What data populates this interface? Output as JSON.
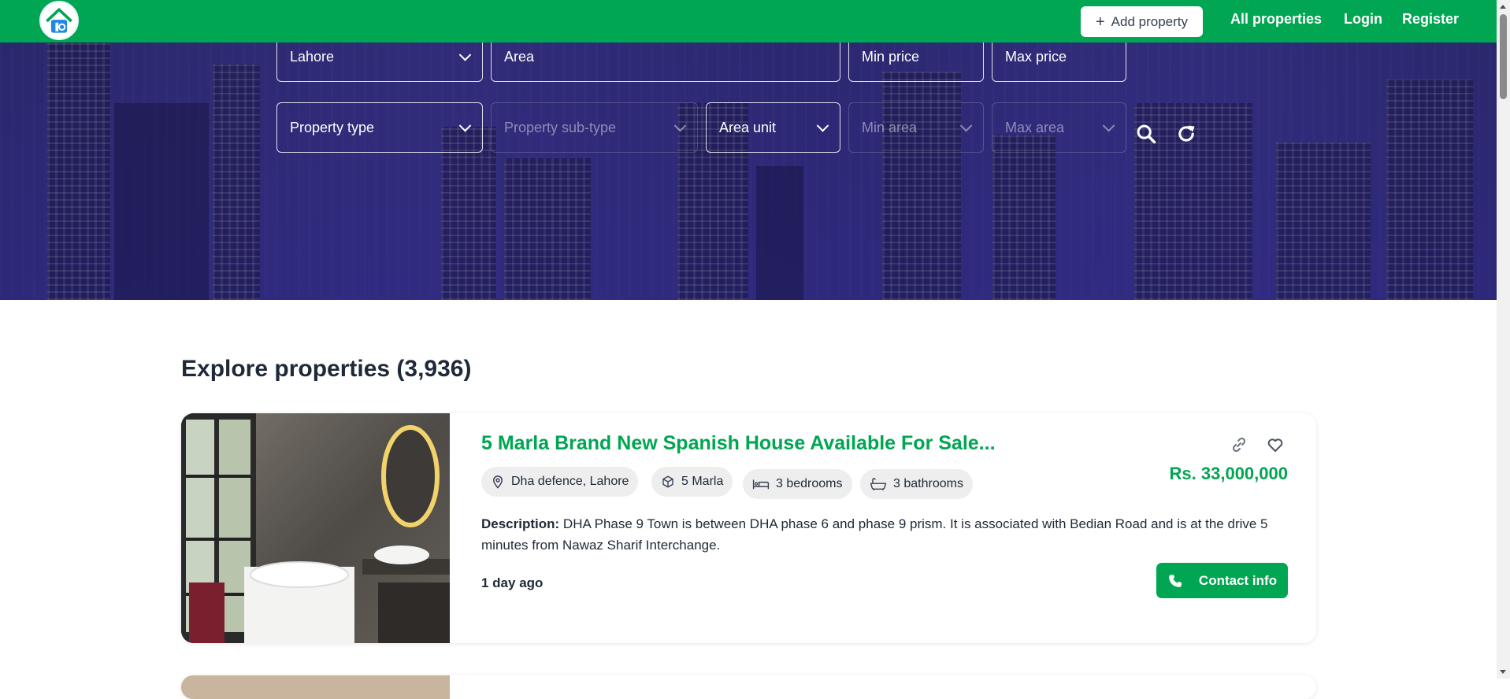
{
  "header": {
    "add_property": "Add property",
    "nav": [
      "All properties",
      "Login",
      "Register"
    ]
  },
  "filters": {
    "city": "Lahore",
    "area": "Area",
    "min_price": "Min price",
    "max_price": "Max price",
    "property_type": "Property type",
    "property_subtype": "Property sub-type",
    "area_unit": "Area unit",
    "min_area": "Min area",
    "max_area": "Max area"
  },
  "listing": {
    "section_title": "Explore properties (3,936)",
    "cards": [
      {
        "title": "5 Marla Brand New Spanish House Available For Sale...",
        "location": "Dha defence, Lahore",
        "size": "5 Marla",
        "bedrooms": "3 bedrooms",
        "bathrooms": "3 bathrooms",
        "price": "Rs. 33,000,000",
        "description_label": "Description:",
        "description": "DHA Phase 9 Town is between DHA phase 6 and phase 9 prism. It is associated with Bedian Road and is at the drive 5 minutes from Nawaz Sharif Interchange.",
        "posted": "1 day ago",
        "contact": "Contact info"
      }
    ]
  },
  "colors": {
    "brand_green": "#00a651",
    "hero_overlay": "#3a3480"
  },
  "icons": [
    "logo-icon",
    "plus-icon",
    "chevron-down-icon",
    "search-icon",
    "refresh-icon",
    "location-pin-icon",
    "cube-icon",
    "bed-icon",
    "bathtub-icon",
    "link-icon",
    "heart-icon",
    "phone-icon"
  ]
}
